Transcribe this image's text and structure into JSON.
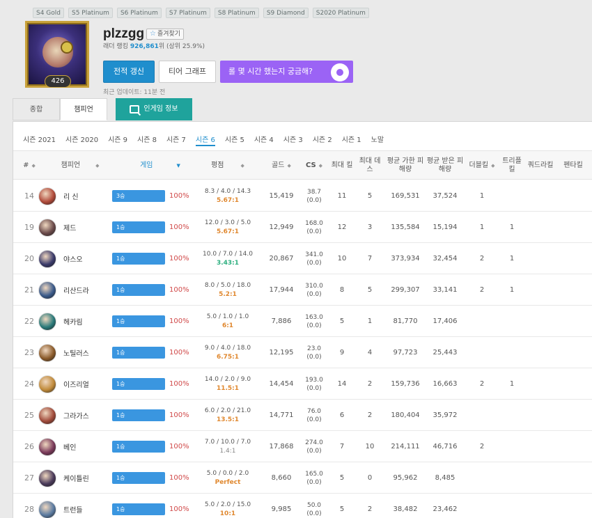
{
  "past_seasons": [
    "S4 Gold",
    "S5 Platinum",
    "S6 Platinum",
    "S7 Platinum",
    "S8 Platinum",
    "S9 Diamond",
    "S2020 Platinum"
  ],
  "profile": {
    "level": "426",
    "name": "plzzgg",
    "favorite_label": "즐겨찾기",
    "ladder_prefix": "래더 랭킹",
    "ladder_rank": "926,861",
    "ladder_suffix": "위 (상위 25.9%)",
    "refresh_label": "전적 갱신",
    "tier_graph_label": "티어 그래프",
    "banner_text": "롤 몇 시간 했는지 궁금해?",
    "updated": "최근 업데이트: 11분 전"
  },
  "tabs": {
    "overview": "종합",
    "champions": "챔피언",
    "ingame": "인게임 정보"
  },
  "seasons": [
    "시즌 2021",
    "시즌 2020",
    "시즌 9",
    "시즌 8",
    "시즌 7",
    "시즌 6",
    "시즌 5",
    "시즌 4",
    "시즌 3",
    "시즌 2",
    "시즌 1",
    "노말"
  ],
  "active_season_index": 5,
  "columns": {
    "rank": "#",
    "champion": "챔피언",
    "games": "게임",
    "kda": "평점",
    "gold": "골드",
    "cs": "CS",
    "max_kills": "최대 킬",
    "max_deaths": "최대 데스",
    "avg_dealt": "평균 가한 피해량",
    "avg_taken": "평균 받은 피해량",
    "double": "더블킬",
    "triple": "트리플킬",
    "quadra": "쿼드라킬",
    "penta": "펜타킬"
  },
  "rows": [
    {
      "rank": "14",
      "champion": "리 신",
      "color": "#b04a3a",
      "wins": "3승",
      "winrate": "100%",
      "kda": "8.3 / 4.0 / 14.3",
      "ratio": "5.67:1",
      "ratio_color": "orange",
      "gold": "15,419",
      "cs": "38.7",
      "cs_pm": "(0.0)",
      "max_kills": "11",
      "max_deaths": "5",
      "dealt": "169,531",
      "taken": "37,524",
      "double": "1",
      "triple": "",
      "quadra": "",
      "penta": ""
    },
    {
      "rank": "19",
      "champion": "제드",
      "color": "#6a4a4a",
      "wins": "1승",
      "winrate": "100%",
      "kda": "12.0 / 3.0 / 5.0",
      "ratio": "5.67:1",
      "ratio_color": "orange",
      "gold": "12,949",
      "cs": "168.0",
      "cs_pm": "(0.0)",
      "max_kills": "12",
      "max_deaths": "3",
      "dealt": "135,584",
      "taken": "15,194",
      "double": "1",
      "triple": "1",
      "quadra": "",
      "penta": ""
    },
    {
      "rank": "20",
      "champion": "야스오",
      "color": "#3a3a6a",
      "wins": "1승",
      "winrate": "100%",
      "kda": "10.0 / 7.0 / 14.0",
      "ratio": "3.43:1",
      "ratio_color": "green",
      "gold": "20,867",
      "cs": "341.0",
      "cs_pm": "(0.0)",
      "max_kills": "10",
      "max_deaths": "7",
      "dealt": "373,934",
      "taken": "32,454",
      "double": "2",
      "triple": "1",
      "quadra": "",
      "penta": ""
    },
    {
      "rank": "21",
      "champion": "리산드라",
      "color": "#3a5a8a",
      "wins": "1승",
      "winrate": "100%",
      "kda": "8.0 / 5.0 / 18.0",
      "ratio": "5.2:1",
      "ratio_color": "orange",
      "gold": "17,944",
      "cs": "310.0",
      "cs_pm": "(0.0)",
      "max_kills": "8",
      "max_deaths": "5",
      "dealt": "299,307",
      "taken": "33,141",
      "double": "2",
      "triple": "1",
      "quadra": "",
      "penta": ""
    },
    {
      "rank": "22",
      "champion": "헤카림",
      "color": "#2a7a7a",
      "wins": "1승",
      "winrate": "100%",
      "kda": "5.0 / 1.0 / 1.0",
      "ratio": "6:1",
      "ratio_color": "orange",
      "gold": "7,886",
      "cs": "163.0",
      "cs_pm": "(0.0)",
      "max_kills": "5",
      "max_deaths": "1",
      "dealt": "81,770",
      "taken": "17,406",
      "double": "",
      "triple": "",
      "quadra": "",
      "penta": ""
    },
    {
      "rank": "23",
      "champion": "노틸러스",
      "color": "#8a5a2a",
      "wins": "1승",
      "winrate": "100%",
      "kda": "9.0 / 4.0 / 18.0",
      "ratio": "6.75:1",
      "ratio_color": "orange",
      "gold": "12,195",
      "cs": "23.0",
      "cs_pm": "(0.0)",
      "max_kills": "9",
      "max_deaths": "4",
      "dealt": "97,723",
      "taken": "25,443",
      "double": "",
      "triple": "",
      "quadra": "",
      "penta": ""
    },
    {
      "rank": "24",
      "champion": "이즈리얼",
      "color": "#c08a3a",
      "wins": "1승",
      "winrate": "100%",
      "kda": "14.0 / 2.0 / 9.0",
      "ratio": "11.5:1",
      "ratio_color": "orange",
      "gold": "14,454",
      "cs": "193.0",
      "cs_pm": "(0.0)",
      "max_kills": "14",
      "max_deaths": "2",
      "dealt": "159,736",
      "taken": "16,663",
      "double": "2",
      "triple": "1",
      "quadra": "",
      "penta": ""
    },
    {
      "rank": "25",
      "champion": "그라가스",
      "color": "#a04a3a",
      "wins": "1승",
      "winrate": "100%",
      "kda": "6.0 / 2.0 / 21.0",
      "ratio": "13.5:1",
      "ratio_color": "orange",
      "gold": "14,771",
      "cs": "76.0",
      "cs_pm": "(0.0)",
      "max_kills": "6",
      "max_deaths": "2",
      "dealt": "180,404",
      "taken": "35,972",
      "double": "",
      "triple": "",
      "quadra": "",
      "penta": ""
    },
    {
      "rank": "26",
      "champion": "베인",
      "color": "#7a3a5a",
      "wins": "1승",
      "winrate": "100%",
      "kda": "7.0 / 10.0 / 7.0",
      "ratio": "1.4:1",
      "ratio_color": "gray",
      "gold": "17,868",
      "cs": "274.0",
      "cs_pm": "(0.0)",
      "max_kills": "7",
      "max_deaths": "10",
      "dealt": "214,111",
      "taken": "46,716",
      "double": "2",
      "triple": "",
      "quadra": "",
      "penta": ""
    },
    {
      "rank": "27",
      "champion": "케이틀린",
      "color": "#4a3a5a",
      "wins": "1승",
      "winrate": "100%",
      "kda": "5.0 / 0.0 / 2.0",
      "ratio": "Perfect",
      "ratio_color": "orange",
      "gold": "8,660",
      "cs": "165.0",
      "cs_pm": "(0.0)",
      "max_kills": "5",
      "max_deaths": "0",
      "dealt": "95,962",
      "taken": "8,485",
      "double": "",
      "triple": "",
      "quadra": "",
      "penta": ""
    },
    {
      "rank": "28",
      "champion": "트런들",
      "color": "#5a7aa0",
      "wins": "1승",
      "winrate": "100%",
      "kda": "5.0 / 2.0 / 15.0",
      "ratio": "10:1",
      "ratio_color": "orange",
      "gold": "9,985",
      "cs": "50.0",
      "cs_pm": "(0.0)",
      "max_kills": "5",
      "max_deaths": "2",
      "dealt": "38,482",
      "taken": "23,462",
      "double": "",
      "triple": "",
      "quadra": "",
      "penta": ""
    }
  ]
}
